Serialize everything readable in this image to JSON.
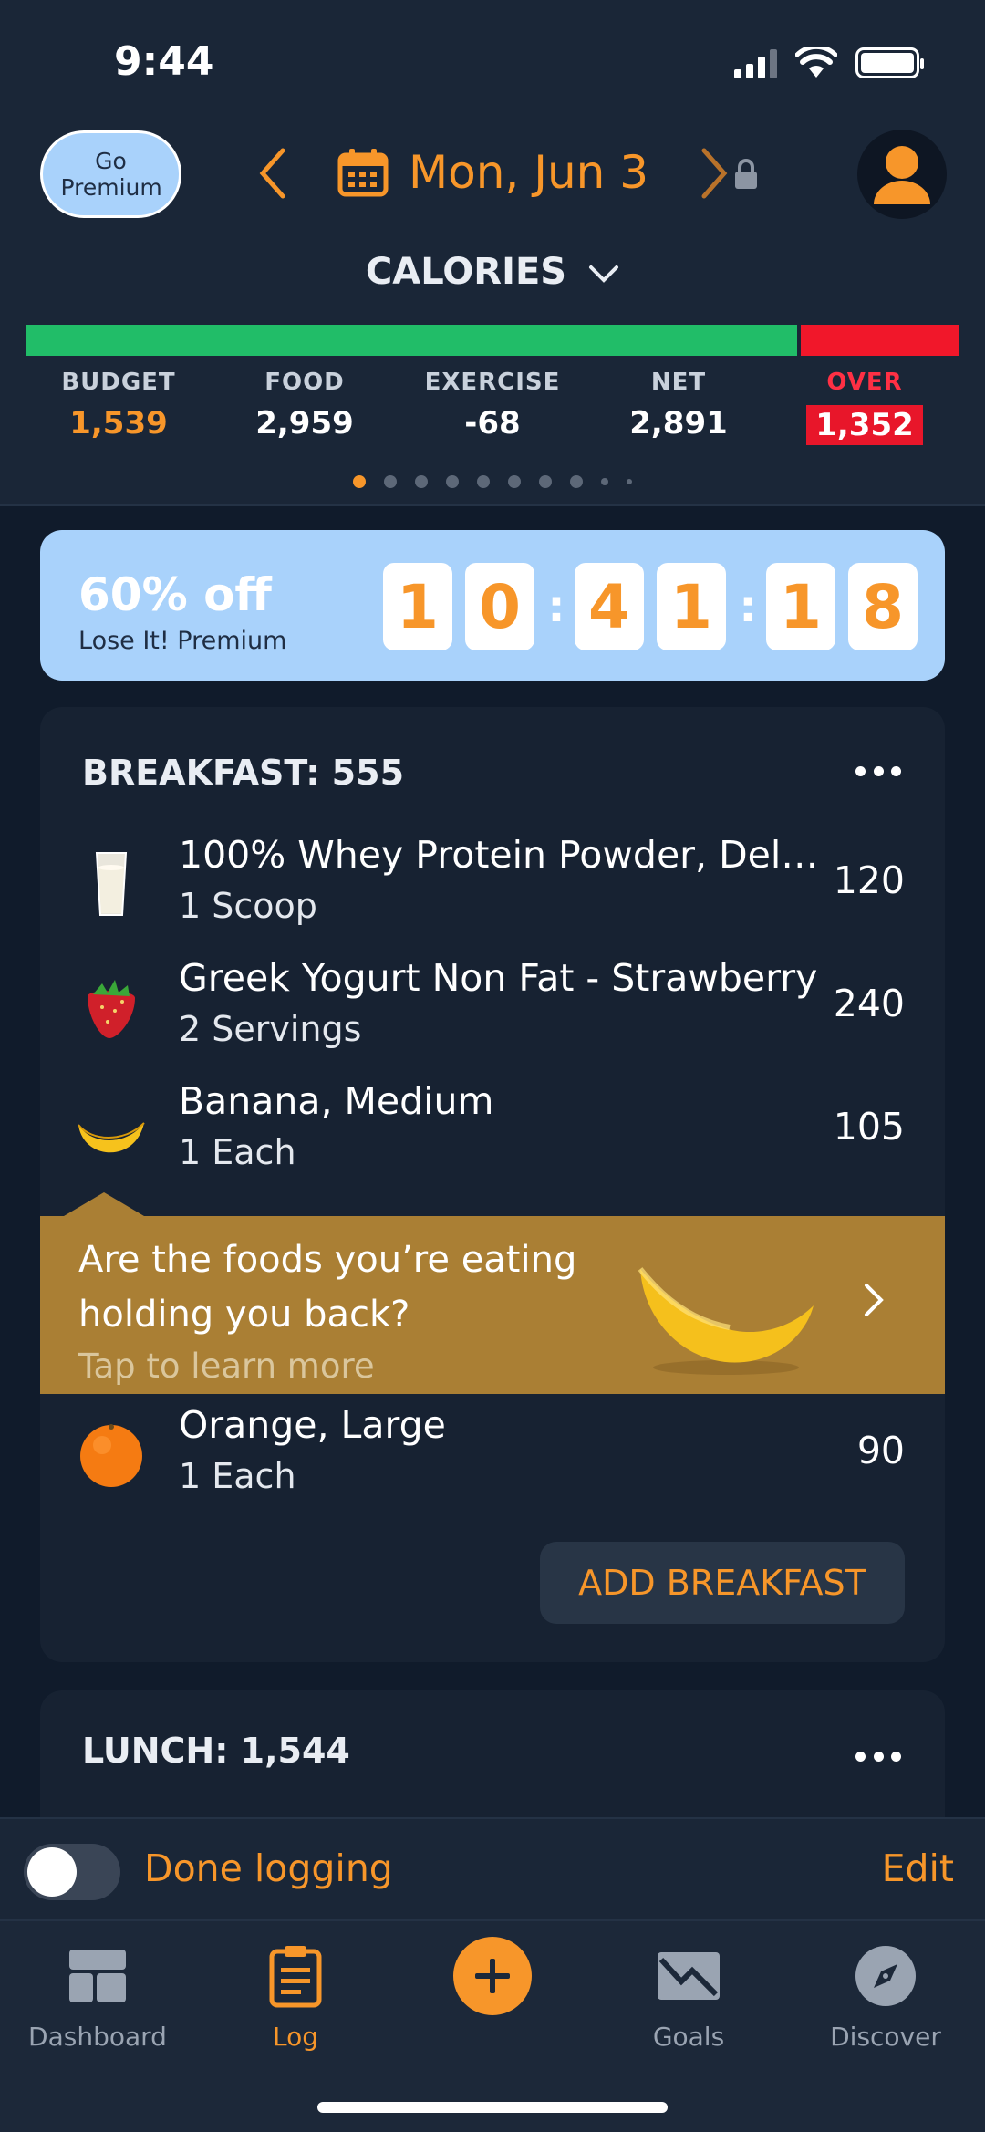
{
  "status": {
    "time": "9:44"
  },
  "header": {
    "premium_label": "Go Premium",
    "date": "Mon, Jun 3",
    "section_title": "CALORIES"
  },
  "calorie_bar": {
    "consumed_fraction": 0.829,
    "over_fraction": 0.171,
    "colors": {
      "ok": "#21bd68",
      "over": "#f1172a"
    }
  },
  "stats": {
    "budget": {
      "label": "BUDGET",
      "value": "1,539"
    },
    "food": {
      "label": "FOOD",
      "value": "2,959"
    },
    "exercise": {
      "label": "EXERCISE",
      "value": "-68"
    },
    "net": {
      "label": "NET",
      "value": "2,891"
    },
    "over": {
      "label": "OVER",
      "value": "1,352"
    }
  },
  "page_dots": {
    "count": 10,
    "active_index": 0
  },
  "promo": {
    "title": "60% off",
    "subtitle": "Lose It! Premium",
    "timer": [
      "1",
      "0",
      "4",
      "1",
      "1",
      "8"
    ]
  },
  "breakfast": {
    "title": "BREAKFAST: 555",
    "items": [
      {
        "name": "100% Whey Protein Powder, Del…",
        "serving": "1 Scoop",
        "calories": "120",
        "icon": "milk-glass-icon"
      },
      {
        "name": "Greek Yogurt Non Fat - Strawberry",
        "serving": "2 Servings",
        "calories": "240",
        "icon": "strawberry-icon"
      },
      {
        "name": "Banana, Medium",
        "serving": "1 Each",
        "calories": "105",
        "icon": "banana-icon"
      },
      {
        "name": "Orange, Large",
        "serving": "1 Each",
        "calories": "90",
        "icon": "orange-icon"
      }
    ],
    "tip": {
      "line1": "Are the foods you’re eating",
      "line2": "holding you back?",
      "cta": "Tap to learn more"
    },
    "add_label": "ADD BREAKFAST"
  },
  "lunch": {
    "title": "LUNCH: 1,544"
  },
  "done_bar": {
    "label": "Done logging",
    "edit": "Edit",
    "toggle_on": false
  },
  "tabs": [
    {
      "label": "Dashboard",
      "icon": "dashboard-icon"
    },
    {
      "label": "Log",
      "icon": "clipboard-icon"
    },
    {
      "label": "",
      "icon": "add-icon"
    },
    {
      "label": "Goals",
      "icon": "goals-icon"
    },
    {
      "label": "Discover",
      "icon": "compass-icon"
    }
  ],
  "colors": {
    "accent": "#f7962a",
    "background": "#101b2b",
    "card": "#172232",
    "promo": "#a9d2fb",
    "tip": "#aa7f34"
  }
}
